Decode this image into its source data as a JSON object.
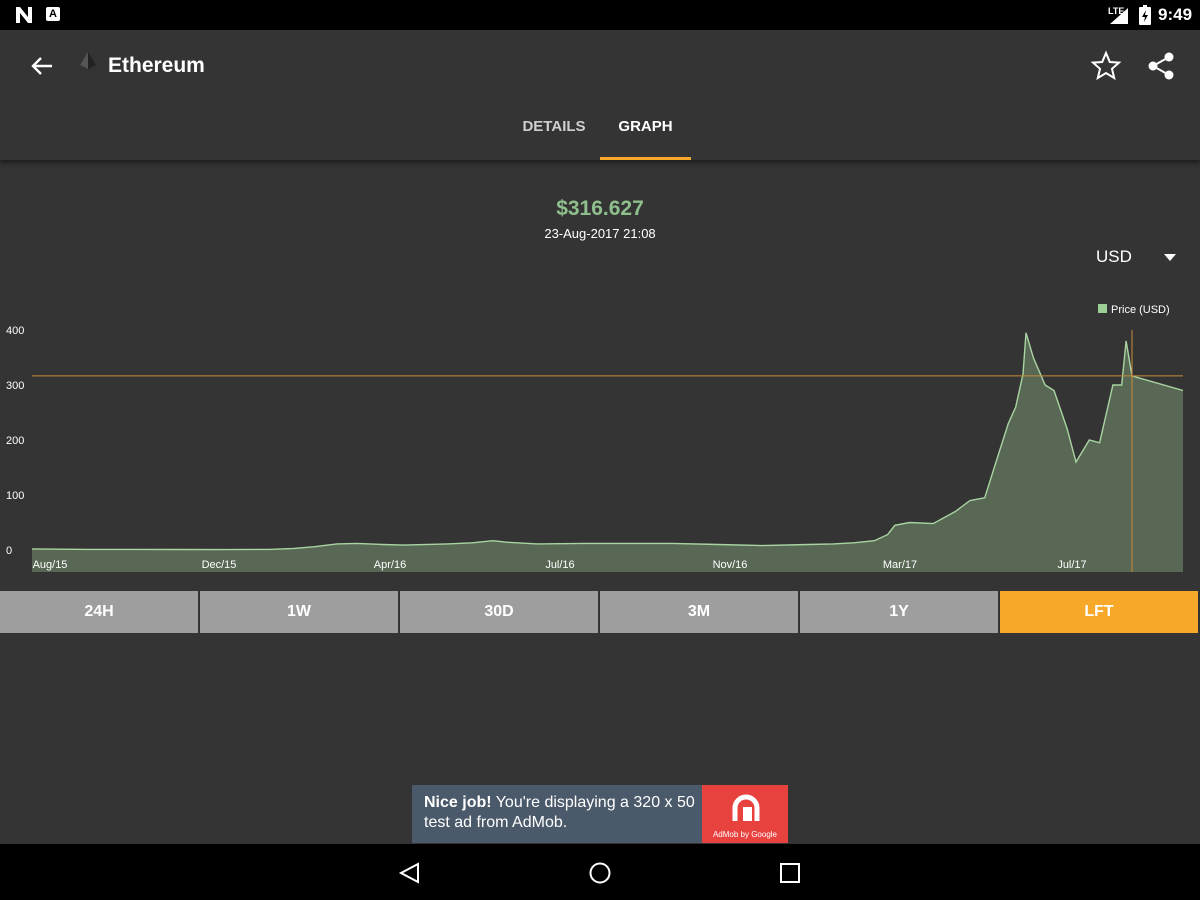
{
  "status_bar": {
    "time": "9:49",
    "network": "LTE",
    "left_icons": [
      "n-notification-icon",
      "a-notification-icon"
    ]
  },
  "header": {
    "title": "Ethereum",
    "icon": "ethereum-icon"
  },
  "tabs": [
    {
      "label": "DETAILS",
      "active": false
    },
    {
      "label": "GRAPH",
      "active": true
    }
  ],
  "price": {
    "value": "$316.627",
    "timestamp": "23-Aug-2017 21:08"
  },
  "currency_selector": {
    "selected": "USD"
  },
  "ranges": [
    {
      "label": "24H",
      "active": false
    },
    {
      "label": "1W",
      "active": false
    },
    {
      "label": "30D",
      "active": false
    },
    {
      "label": "3M",
      "active": false
    },
    {
      "label": "1Y",
      "active": false
    },
    {
      "label": "LFT",
      "active": true
    }
  ],
  "ad": {
    "bold": "Nice job!",
    "text": " You're displaying a 320 x 50 test ad from AdMob.",
    "brand": "AdMob by Google"
  },
  "colors": {
    "accent": "#f8a828",
    "price_green": "#8fbf8c",
    "series_fill": "#5c6e58",
    "background": "#343434"
  },
  "chart_data": {
    "type": "area",
    "xlabel": "",
    "ylabel": "",
    "ylim": [
      0,
      400
    ],
    "yticks": [
      0,
      100,
      200,
      300,
      400
    ],
    "grid": false,
    "legend": {
      "position": "top-right",
      "entries": [
        "Price (USD)"
      ]
    },
    "x_tick_labels": [
      "Aug/15",
      "Dec/15",
      "Apr/16",
      "Jul/16",
      "Nov/16",
      "Mar/17",
      "Jul/17"
    ],
    "highlight": {
      "x": "2017-08-23",
      "y": 316.627
    },
    "series": [
      {
        "name": "Price (USD)",
        "x": [
          "2015-08-07",
          "2015-09-15",
          "2015-10-15",
          "2015-11-15",
          "2015-12-15",
          "2016-01-15",
          "2016-02-01",
          "2016-02-15",
          "2016-03-01",
          "2016-03-15",
          "2016-04-01",
          "2016-04-15",
          "2016-05-15",
          "2016-06-01",
          "2016-06-15",
          "2016-06-25",
          "2016-07-15",
          "2016-08-15",
          "2016-09-15",
          "2016-10-15",
          "2016-11-15",
          "2016-12-15",
          "2017-01-15",
          "2017-02-01",
          "2017-02-15",
          "2017-03-01",
          "2017-03-10",
          "2017-03-15",
          "2017-03-25",
          "2017-04-10",
          "2017-04-25",
          "2017-05-05",
          "2017-05-15",
          "2017-05-25",
          "2017-05-31",
          "2017-06-05",
          "2017-06-10",
          "2017-06-12",
          "2017-06-17",
          "2017-06-25",
          "2017-07-01",
          "2017-07-10",
          "2017-07-16",
          "2017-07-25",
          "2017-08-01",
          "2017-08-10",
          "2017-08-16",
          "2017-08-19",
          "2017-08-23"
        ],
        "values": [
          2,
          1,
          1,
          0.9,
          0.8,
          1,
          3,
          6,
          11,
          12,
          10,
          9,
          11,
          13,
          17,
          14,
          11,
          12,
          12,
          12,
          10,
          8,
          10,
          11,
          13,
          17,
          28,
          45,
          50,
          48,
          70,
          90,
          95,
          180,
          230,
          260,
          320,
          395,
          350,
          300,
          290,
          220,
          160,
          200,
          195,
          300,
          300,
          380,
          316.6
        ]
      }
    ]
  }
}
